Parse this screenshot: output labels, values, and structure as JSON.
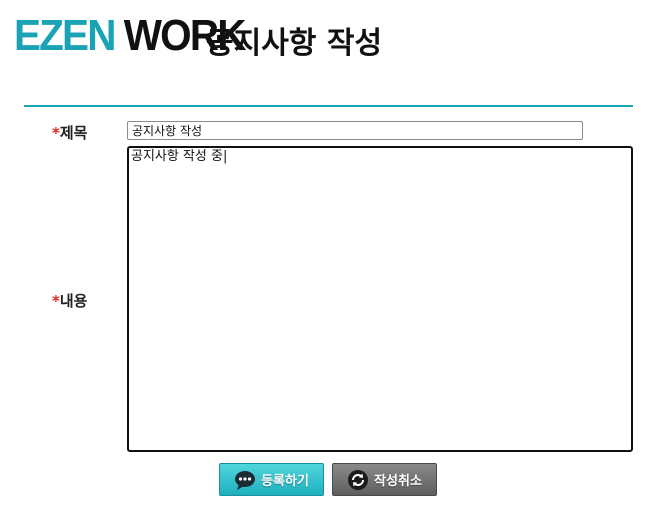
{
  "header": {
    "logo_part1": "EZEN",
    "logo_part2": "WORK",
    "page_title": "공지사항 작성"
  },
  "form": {
    "required_mark": "*",
    "title_label": "제목",
    "title_value": "공지사항 작성",
    "content_label": "내용",
    "content_value": "공지사항 작성 중|"
  },
  "buttons": {
    "submit": {
      "label": "등록하기",
      "icon": "chat-bubble-icon"
    },
    "cancel": {
      "label": "작성취소",
      "icon": "refresh-icon"
    }
  },
  "colors": {
    "accent": "#1aa3b5",
    "required": "#e0261b",
    "cancel": "#6e6e6e"
  }
}
